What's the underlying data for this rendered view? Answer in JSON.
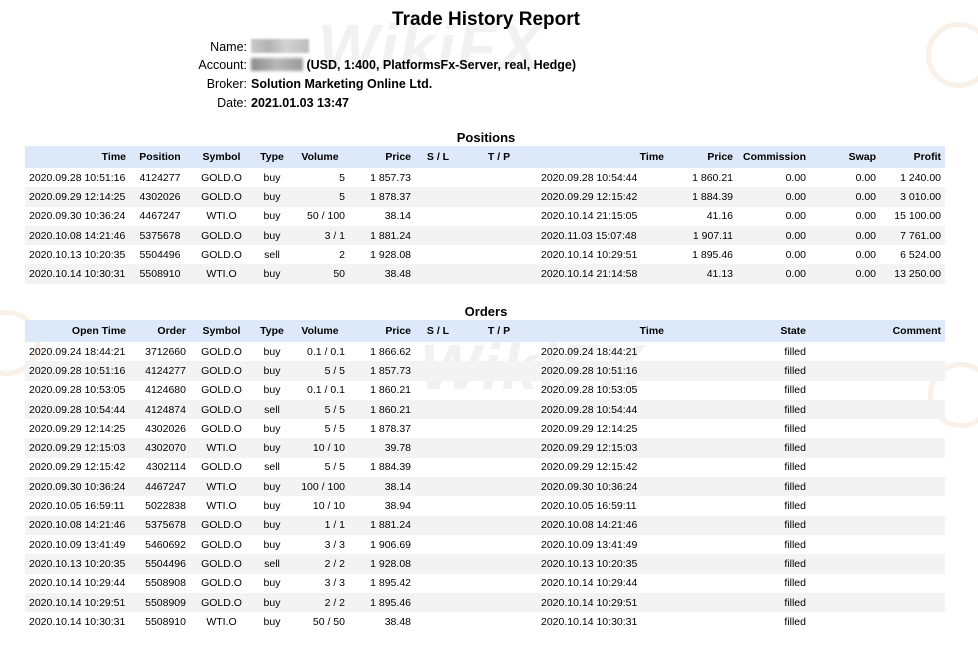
{
  "report": {
    "title": "Trade History Report",
    "name_label": "Name:",
    "account_label": "Account:",
    "account_value": "(USD, 1:400, PlatformsFx-Server, real, Hedge)",
    "broker_label": "Broker:",
    "broker_value": "Solution Marketing Online Ltd.",
    "date_label": "Date:",
    "date_value": "2021.01.03 13:47"
  },
  "watermark": {
    "text": "WikiFX"
  },
  "positions": {
    "title": "Positions",
    "headers": [
      "Time",
      "Position",
      "Symbol",
      "Type",
      "Volume",
      "Price",
      "S / L",
      "T / P",
      "Time",
      "Price",
      "Commission",
      "Swap",
      "Profit"
    ],
    "rows": [
      [
        "2020.09.28 10:51:16",
        "4124277",
        "GOLD.O",
        "buy",
        "5",
        "1 857.73",
        "",
        "",
        "2020.09.28 10:54:44",
        "1 860.21",
        "0.00",
        "0.00",
        "1 240.00"
      ],
      [
        "2020.09.29 12:14:25",
        "4302026",
        "GOLD.O",
        "buy",
        "5",
        "1 878.37",
        "",
        "",
        "2020.09.29 12:15:42",
        "1 884.39",
        "0.00",
        "0.00",
        "3 010.00"
      ],
      [
        "2020.09.30 10:36:24",
        "4467247",
        "WTI.O",
        "buy",
        "50 / 100",
        "38.14",
        "",
        "",
        "2020.10.14 21:15:05",
        "41.16",
        "0.00",
        "0.00",
        "15 100.00"
      ],
      [
        "2020.10.08 14:21:46",
        "5375678",
        "GOLD.O",
        "buy",
        "3 / 1",
        "1 881.24",
        "",
        "",
        "2020.11.03 15:07:48",
        "1 907.11",
        "0.00",
        "0.00",
        "7 761.00"
      ],
      [
        "2020.10.13 10:20:35",
        "5504496",
        "GOLD.O",
        "sell",
        "2",
        "1 928.08",
        "",
        "",
        "2020.10.14 10:29:51",
        "1 895.46",
        "0.00",
        "0.00",
        "6 524.00"
      ],
      [
        "2020.10.14 10:30:31",
        "5508910",
        "WTI.O",
        "buy",
        "50",
        "38.48",
        "",
        "",
        "2020.10.14 21:14:58",
        "41.13",
        "0.00",
        "0.00",
        "13 250.00"
      ]
    ]
  },
  "orders": {
    "title": "Orders",
    "headers": [
      "Open Time",
      "Order",
      "Symbol",
      "Type",
      "Volume",
      "Price",
      "S / L",
      "T / P",
      "Time",
      "State",
      "Comment"
    ],
    "rows": [
      [
        "2020.09.24 18:44:21",
        "3712660",
        "GOLD.O",
        "buy",
        "0.1 / 0.1",
        "1 866.62",
        "",
        "",
        "2020.09.24 18:44:21",
        "filled",
        ""
      ],
      [
        "2020.09.28 10:51:16",
        "4124277",
        "GOLD.O",
        "buy",
        "5 / 5",
        "1 857.73",
        "",
        "",
        "2020.09.28 10:51:16",
        "filled",
        ""
      ],
      [
        "2020.09.28 10:53:05",
        "4124680",
        "GOLD.O",
        "buy",
        "0.1 / 0.1",
        "1 860.21",
        "",
        "",
        "2020.09.28 10:53:05",
        "filled",
        ""
      ],
      [
        "2020.09.28 10:54:44",
        "4124874",
        "GOLD.O",
        "sell",
        "5 / 5",
        "1 860.21",
        "",
        "",
        "2020.09.28 10:54:44",
        "filled",
        ""
      ],
      [
        "2020.09.29 12:14:25",
        "4302026",
        "GOLD.O",
        "buy",
        "5 / 5",
        "1 878.37",
        "",
        "",
        "2020.09.29 12:14:25",
        "filled",
        ""
      ],
      [
        "2020.09.29 12:15:03",
        "4302070",
        "WTI.O",
        "buy",
        "10 / 10",
        "39.78",
        "",
        "",
        "2020.09.29 12:15:03",
        "filled",
        ""
      ],
      [
        "2020.09.29 12:15:42",
        "4302114",
        "GOLD.O",
        "sell",
        "5 / 5",
        "1 884.39",
        "",
        "",
        "2020.09.29 12:15:42",
        "filled",
        ""
      ],
      [
        "2020.09.30 10:36:24",
        "4467247",
        "WTI.O",
        "buy",
        "100 / 100",
        "38.14",
        "",
        "",
        "2020.09.30 10:36:24",
        "filled",
        ""
      ],
      [
        "2020.10.05 16:59:11",
        "5022838",
        "WTI.O",
        "buy",
        "10 / 10",
        "38.94",
        "",
        "",
        "2020.10.05 16:59:11",
        "filled",
        ""
      ],
      [
        "2020.10.08 14:21:46",
        "5375678",
        "GOLD.O",
        "buy",
        "1 / 1",
        "1 881.24",
        "",
        "",
        "2020.10.08 14:21:46",
        "filled",
        ""
      ],
      [
        "2020.10.09 13:41:49",
        "5460692",
        "GOLD.O",
        "buy",
        "3 / 3",
        "1 906.69",
        "",
        "",
        "2020.10.09 13:41:49",
        "filled",
        ""
      ],
      [
        "2020.10.13 10:20:35",
        "5504496",
        "GOLD.O",
        "sell",
        "2 / 2",
        "1 928.08",
        "",
        "",
        "2020.10.13 10:20:35",
        "filled",
        ""
      ],
      [
        "2020.10.14 10:29:44",
        "5508908",
        "GOLD.O",
        "buy",
        "3 / 3",
        "1 895.42",
        "",
        "",
        "2020.10.14 10:29:44",
        "filled",
        ""
      ],
      [
        "2020.10.14 10:29:51",
        "5508909",
        "GOLD.O",
        "buy",
        "2 / 2",
        "1 895.46",
        "",
        "",
        "2020.10.14 10:29:51",
        "filled",
        ""
      ],
      [
        "2020.10.14 10:30:31",
        "5508910",
        "WTI.O",
        "buy",
        "50 / 50",
        "38.48",
        "",
        "",
        "2020.10.14 10:30:31",
        "filled",
        ""
      ]
    ]
  }
}
